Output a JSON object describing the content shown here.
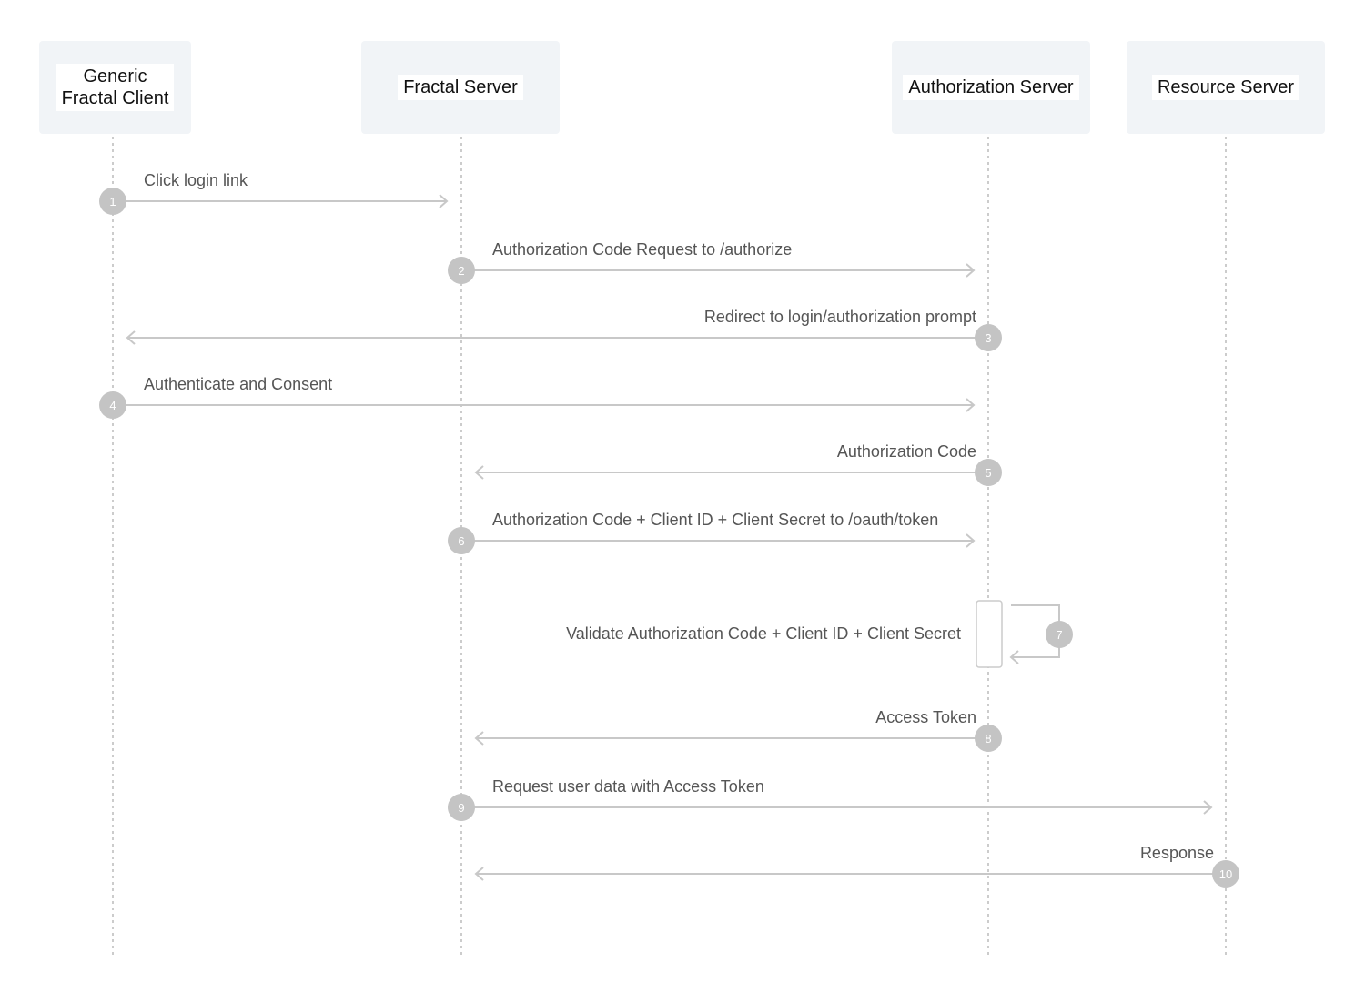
{
  "participants": [
    {
      "name": "Generic\nFractal Client"
    },
    {
      "name": "Fractal Server"
    },
    {
      "name": "Authorization Server"
    },
    {
      "name": "Resource Server"
    }
  ],
  "messages": [
    {
      "number": "1",
      "from": 0,
      "to": 1,
      "label": "Click login link"
    },
    {
      "number": "2",
      "from": 1,
      "to": 2,
      "label": "Authorization Code Request to /authorize"
    },
    {
      "number": "3",
      "from": 2,
      "to": 0,
      "label": "Redirect to login/authorization prompt"
    },
    {
      "number": "4",
      "from": 0,
      "to": 2,
      "label": "Authenticate and Consent"
    },
    {
      "number": "5",
      "from": 2,
      "to": 1,
      "label": "Authorization Code"
    },
    {
      "number": "6",
      "from": 1,
      "to": 2,
      "label": "Authorization Code + Client ID + Client Secret to /oauth/token"
    },
    {
      "number": "7",
      "from": 2,
      "to": 2,
      "label": "Validate Authorization Code + Client ID + Client Secret"
    },
    {
      "number": "8",
      "from": 2,
      "to": 1,
      "label": "Access Token"
    },
    {
      "number": "9",
      "from": 1,
      "to": 3,
      "label": "Request user data with Access Token"
    },
    {
      "number": "10",
      "from": 3,
      "to": 1,
      "label": "Response"
    }
  ],
  "colors": {
    "header_bg": "#f1f4f7",
    "line": "#c8c8c8",
    "badge": "#c4c4c4",
    "text": "#555555"
  }
}
